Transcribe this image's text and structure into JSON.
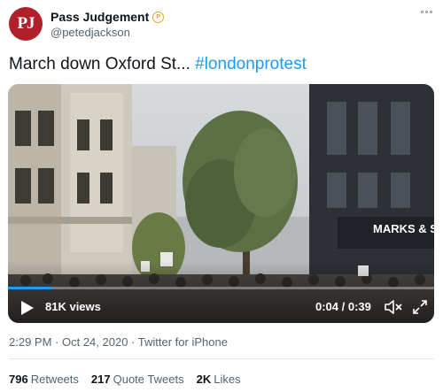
{
  "author": {
    "avatar_text": "PJ",
    "display_name": "Pass Judgement",
    "badge_glyph": "P",
    "handle": "@petedjackson"
  },
  "tweet": {
    "text": "March down Oxford St... ",
    "hashtag": "#londonprotest"
  },
  "video": {
    "views": "81K views",
    "time": "0:04 / 0:39",
    "storefront_sign": "MARKS & SPE"
  },
  "meta": {
    "time": "2:29 PM",
    "separator1": " · ",
    "date": "Oct 24, 2020",
    "separator2": " · ",
    "source": "Twitter for iPhone"
  },
  "stats": {
    "retweets_count": "796",
    "retweets_label": "Retweets",
    "quotes_count": "217",
    "quotes_label": "Quote Tweets",
    "likes_count": "2K",
    "likes_label": "Likes"
  },
  "colors": {
    "brand_red": "#b01f2a",
    "link_blue": "#1d9bf0",
    "badge_gold": "#e7a321"
  },
  "icons": [
    "more-options-icon",
    "play-icon",
    "mute-icon",
    "fullscreen-icon",
    "verified-badge-icon"
  ]
}
